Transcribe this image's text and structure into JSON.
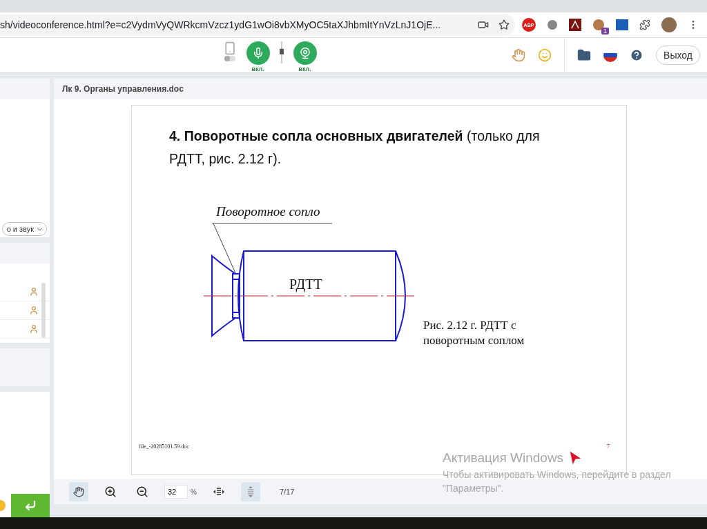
{
  "browser": {
    "url": "sh/videoconference.html?e=c2VydmVyQWRkcmVzcz1ydG1wOi8vbXMyOC5taXJhbmItYnVzLnJ1OjE...",
    "adblock_label": "ABP",
    "extension_badge": "1"
  },
  "toolbar": {
    "phone_toggle": {
      "on": false
    },
    "volume": {
      "level": 0.55
    },
    "mic": {
      "label": "вкл.",
      "on": true
    },
    "camera": {
      "label": "вкл.",
      "on": true
    },
    "exit_button": "Выход"
  },
  "sidebar": {
    "media_dropdown": "о и звук"
  },
  "document": {
    "title": "Лк 9. Органы управления.doc",
    "heading": "**4. Поворотные сопла основных двигателей** (только для РДТТ, рис. 2.12 г).",
    "figure": {
      "callout": "Поворотное сопло",
      "body_label": "РДТТ",
      "caption": "Рис. 2.12 г. РДТТ с поворотным соплом"
    },
    "footer_file": "file_-20285101.59.doc",
    "page_number": "7"
  },
  "viewer_toolbar": {
    "hand_selected": true,
    "zoom": "32",
    "percent": "%",
    "pages": "7/17"
  },
  "os_overlay": {
    "title": "Активация Windows",
    "text": "Чтобы активировать Windows, перейдите в раздел \"Параметры\"."
  }
}
